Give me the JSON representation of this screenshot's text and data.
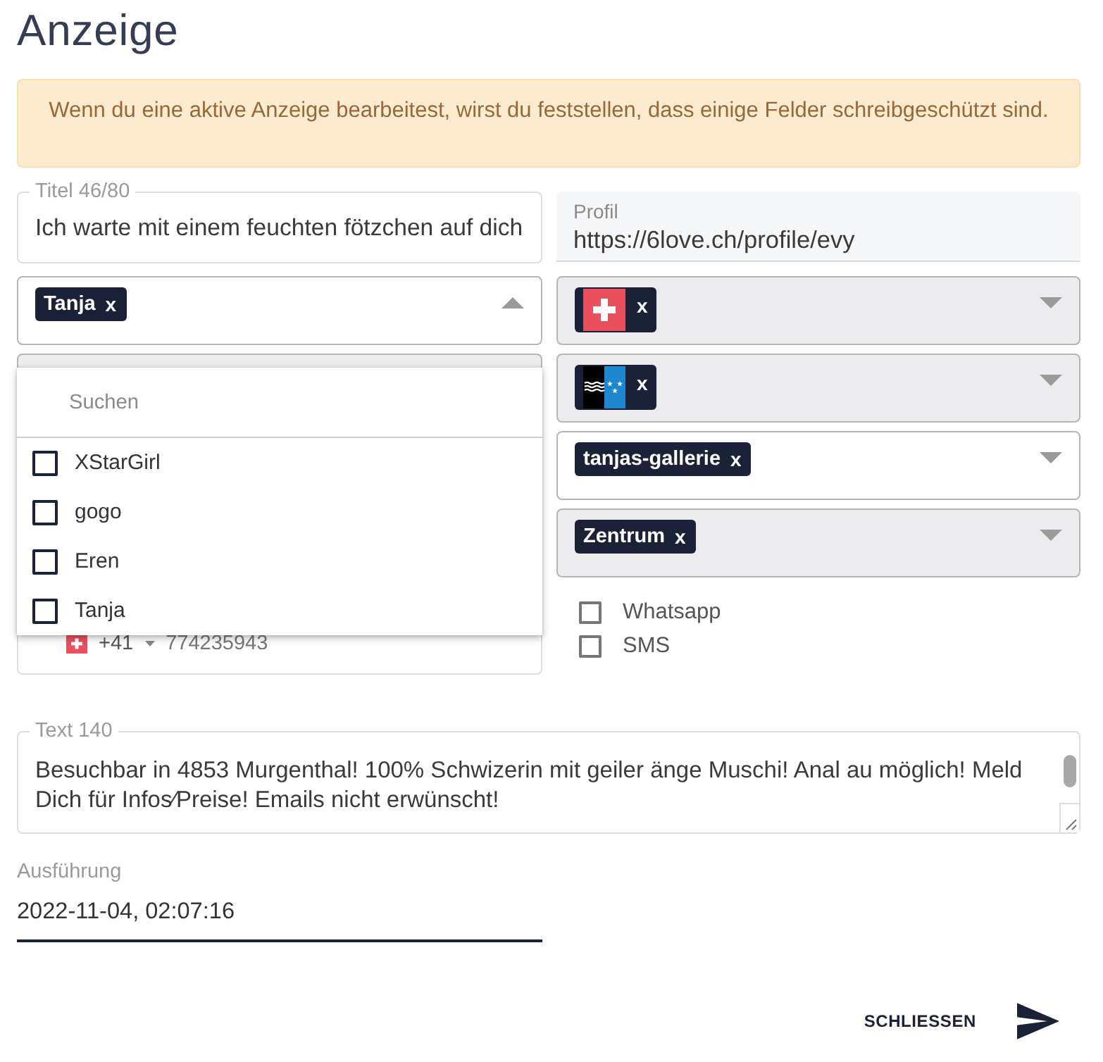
{
  "header": {
    "title": "Anzeige"
  },
  "notice": {
    "text": "Wenn du eine aktive Anzeige bearbeitest, wirst du feststellen, dass einige Felder schreibgeschützt sind."
  },
  "title_field": {
    "label": "Titel 46/80",
    "value": "Ich warte mit einem feuchten fötzchen auf dich"
  },
  "profile_field": {
    "label": "Profil",
    "value": "https://6love.ch/profile/evy"
  },
  "left_selects": [
    {
      "expanded": true,
      "disabled": false,
      "chips": [
        {
          "kind": "text",
          "label": "Tanja",
          "remove": "x"
        }
      ]
    },
    {
      "disabled": true
    }
  ],
  "dropdown": {
    "search_placeholder": "Suchen",
    "options": [
      {
        "label": "XStarGirl",
        "checked": false
      },
      {
        "label": "gogo",
        "checked": false
      },
      {
        "label": "Eren",
        "checked": false
      },
      {
        "label": "Tanja",
        "checked": false
      }
    ]
  },
  "phone_field": {
    "country_code": "+41",
    "number": "774235943"
  },
  "right_selects": [
    {
      "expanded": false,
      "disabled": true,
      "chips": [
        {
          "kind": "swiss",
          "remove": "x"
        }
      ]
    },
    {
      "expanded": false,
      "disabled": true,
      "chips": [
        {
          "kind": "aargau",
          "remove": "x"
        }
      ]
    },
    {
      "expanded": false,
      "disabled": false,
      "chips": [
        {
          "kind": "text",
          "label": "tanjas-gallerie",
          "remove": "x"
        }
      ]
    },
    {
      "expanded": false,
      "disabled": true,
      "chips": [
        {
          "kind": "text",
          "label": "Zentrum",
          "remove": "x"
        }
      ]
    }
  ],
  "contact_options": [
    {
      "label": "Whatsapp",
      "checked": false
    },
    {
      "label": "SMS",
      "checked": false
    }
  ],
  "text_field": {
    "label": "Text 140",
    "value": "Besuchbar in 4853 Murgenthal! 100% Schwizerin mit geiler änge Muschi! Anal au möglich! Meld Dich für Infos⁄Preise! Emails nicht erwünscht!"
  },
  "execution_field": {
    "label": "Ausführung",
    "value": "2022-11-04, 02:07:16"
  },
  "actions": {
    "close": "SCHLIESSEN"
  }
}
